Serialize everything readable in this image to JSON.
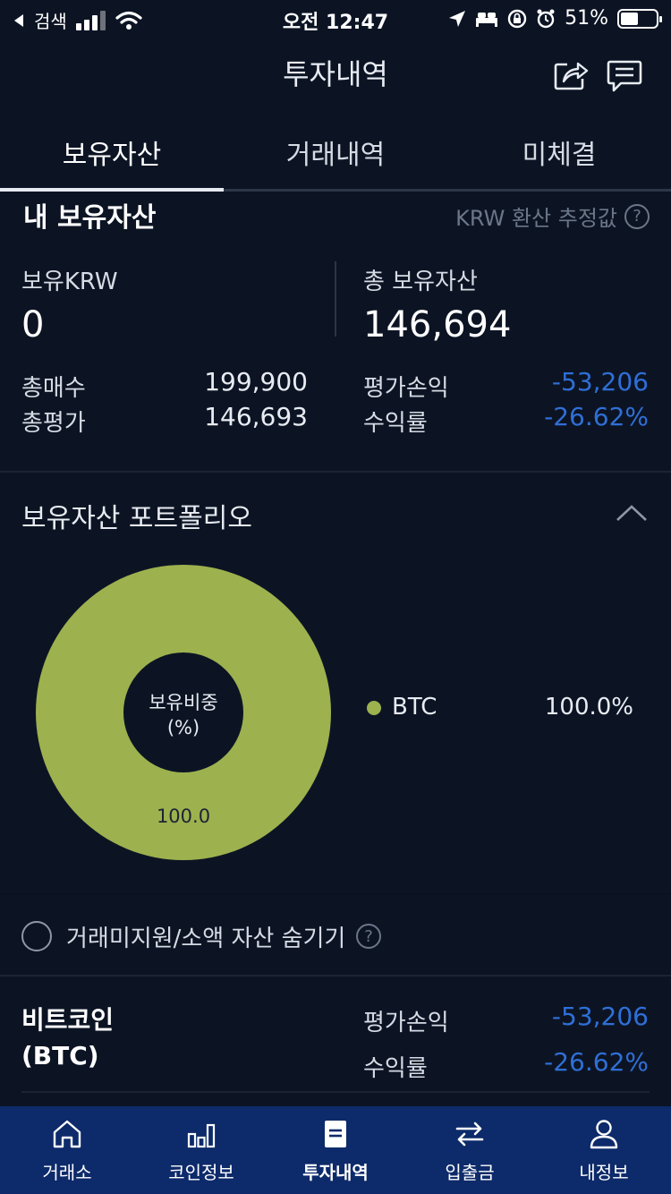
{
  "status_bar": {
    "back_label": "검색",
    "time": "오전 12:47",
    "battery": "51%"
  },
  "header": {
    "title": "투자내역"
  },
  "tabs": [
    {
      "label": "보유자산",
      "active": true
    },
    {
      "label": "거래내역",
      "active": false
    },
    {
      "label": "미체결",
      "active": false
    }
  ],
  "my_assets": {
    "title": "내 보유자산",
    "note": "KRW 환산 추정값",
    "help": "?",
    "krw_label": "보유KRW",
    "krw_value": "0",
    "total_label": "총 보유자산",
    "total_value": "146,694",
    "total_buy_label": "총매수",
    "total_buy_value": "199,900",
    "total_eval_label": "총평가",
    "total_eval_value": "146,693",
    "pnl_label": "평가손익",
    "pnl_value": "-53,206",
    "return_label": "수익률",
    "return_value": "-26.62%"
  },
  "portfolio": {
    "title": "보유자산 포트폴리오",
    "center_label_line1": "보유비중",
    "center_label_line2": "(%)",
    "legend": [
      {
        "name": "BTC",
        "pct": "100.0%",
        "color": "#9db14e"
      }
    ]
  },
  "chart_data": {
    "type": "pie",
    "categories": [
      "BTC"
    ],
    "values": [
      100.0
    ],
    "data_labels": [
      "100.0"
    ],
    "colors": [
      "#9db14e"
    ]
  },
  "hide_toggle": {
    "label": "거래미지원/소액 자산 숨기기",
    "help": "?"
  },
  "coin": {
    "name_line1": "비트코인",
    "name_line2": "(BTC)",
    "pnl_label": "평가손익",
    "pnl_value": "-53,206",
    "return_label": "수익률",
    "return_value": "-26.62%"
  },
  "bottom_nav": [
    {
      "label": "거래소",
      "icon": "home-icon",
      "active": false
    },
    {
      "label": "코인정보",
      "icon": "bar-chart-icon",
      "active": false
    },
    {
      "label": "투자내역",
      "icon": "document-icon",
      "active": true
    },
    {
      "label": "입출금",
      "icon": "transfer-icon",
      "active": false
    },
    {
      "label": "내정보",
      "icon": "person-icon",
      "active": false
    }
  ],
  "colors": {
    "background": "#0c1424",
    "negative": "#2f6fd6",
    "chart_green": "#9db14e",
    "nav_bg": "#0d2a6a"
  }
}
